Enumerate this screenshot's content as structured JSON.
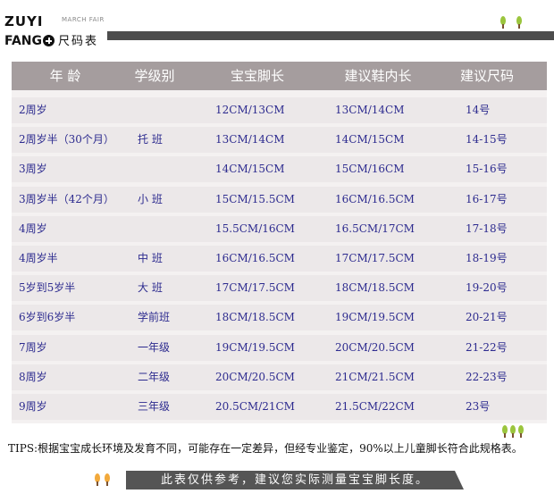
{
  "brand": {
    "name": "ZUYI",
    "sub": "MARCH FAIR",
    "fang": "FANG",
    "title": "尺码表"
  },
  "table": {
    "headers": [
      "年  龄",
      "学级别",
      "宝宝脚长",
      "建议鞋内长",
      "建议尺码"
    ],
    "rows": [
      {
        "age": "2周岁",
        "level": "",
        "foot": "12CM/13CM",
        "inner": "13CM/14CM",
        "size": "14号"
      },
      {
        "age": "2周岁半（30个月）",
        "level": "托  班",
        "foot": "13CM/14CM",
        "inner": "14CM/15CM",
        "size": "14-15号"
      },
      {
        "age": "3周岁",
        "level": "",
        "foot": "14CM/15CM",
        "inner": "15CM/16CM",
        "size": "15-16号"
      },
      {
        "age": "3周岁半（42个月）",
        "level": "小  班",
        "foot": "15CM/15.5CM",
        "inner": "16CM/16.5CM",
        "size": "16-17号"
      },
      {
        "age": "4周岁",
        "level": "",
        "foot": "15.5CM/16CM",
        "inner": "16.5CM/17CM",
        "size": "17-18号"
      },
      {
        "age": "4周岁半",
        "level": "中  班",
        "foot": "16CM/16.5CM",
        "inner": "17CM/17.5CM",
        "size": "18-19号"
      },
      {
        "age": "5岁到5岁半",
        "level": "大  班",
        "foot": "17CM/17.5CM",
        "inner": "18CM/18.5CM",
        "size": "19-20号"
      },
      {
        "age": "6岁到6岁半",
        "level": "学前班",
        "foot": "18CM/18.5CM",
        "inner": "19CM/19.5CM",
        "size": "20-21号"
      },
      {
        "age": "7周岁",
        "level": "一年级",
        "foot": "19CM/19.5CM",
        "inner": "20CM/20.5CM",
        "size": "21-22号"
      },
      {
        "age": "8周岁",
        "level": "二年级",
        "foot": "20CM/20.5CM",
        "inner": "21CM/21.5CM",
        "size": "22-23号"
      },
      {
        "age": "9周岁",
        "level": "三年级",
        "foot": "20.5CM/21CM",
        "inner": "21.5CM/22CM",
        "size": "23号"
      }
    ]
  },
  "tips": "TIPS:根据宝宝成长环境及发育不同，可能存在一定差异，但经专业鉴定，90%以上儿童脚长符合此规格表。",
  "footer_note": "此表仅供参考，建议您实际测量宝宝脚长度。",
  "colors": {
    "header_bg": "#a59d9e",
    "row_bg": "#ece8e9",
    "cell_text": "#2d2b8f",
    "bar": "#4d4d4d"
  }
}
